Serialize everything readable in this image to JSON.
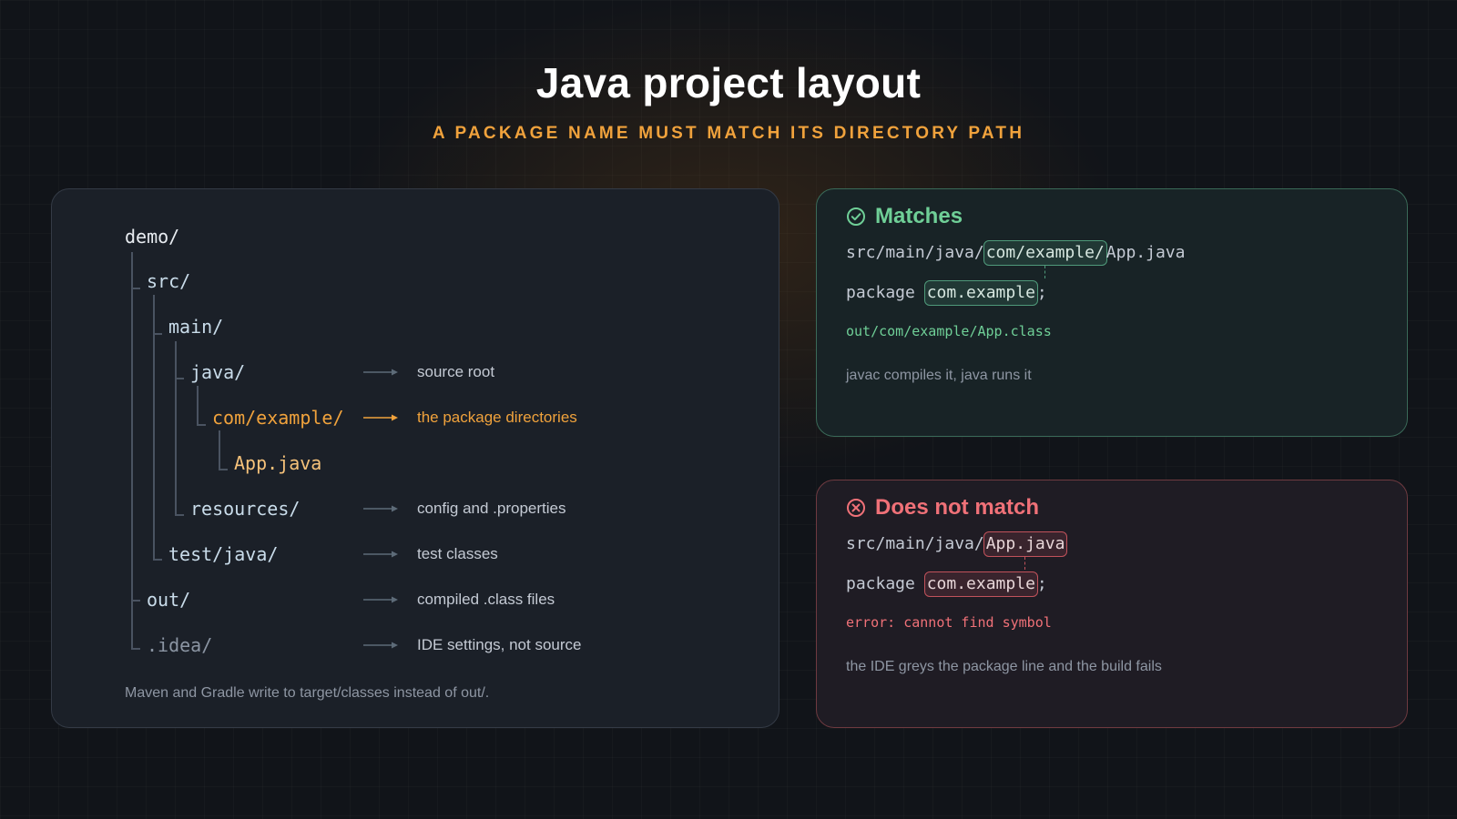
{
  "header": {
    "title": "Java project layout",
    "subtitle": "A PACKAGE NAME MUST MATCH ITS DIRECTORY PATH"
  },
  "tree": {
    "nodes": [
      {
        "label": "demo/"
      },
      {
        "label": "src/"
      },
      {
        "label": "main/"
      },
      {
        "label": "java/",
        "note": "source root"
      },
      {
        "label": "com/example/",
        "note": "the package directories"
      },
      {
        "label": "App.java"
      },
      {
        "label": "resources/",
        "note": "config and .properties"
      },
      {
        "label": "test/java/",
        "note": "test classes"
      },
      {
        "label": "out/",
        "note": "compiled .class files"
      },
      {
        "label": ".idea/",
        "note": "IDE settings, not source"
      }
    ],
    "footnote": "Maven and Gradle write to target/classes instead of out/."
  },
  "matches": {
    "title": "Matches",
    "icon": "check-circle-icon",
    "path_prefix": "src/main/java/",
    "path_highlight": "com/example/",
    "path_suffix": "App.java",
    "package_keyword": "package ",
    "package_name": "com.example",
    "package_semicolon": ";",
    "output": "out/com/example/App.class",
    "caption": "javac compiles it, java runs it",
    "accent": "#6fcf97"
  },
  "mismatch": {
    "title": "Does not match",
    "icon": "x-circle-icon",
    "path_prefix": "src/main/java/",
    "path_highlight": "App.java",
    "package_keyword": "package ",
    "package_name": "com.example",
    "package_semicolon": ";",
    "output": "error: cannot find symbol",
    "caption": "the IDE greys the package line and the build fails",
    "accent": "#f07178"
  },
  "colors": {
    "highlight": "#f0a23c",
    "background": "#111419"
  }
}
